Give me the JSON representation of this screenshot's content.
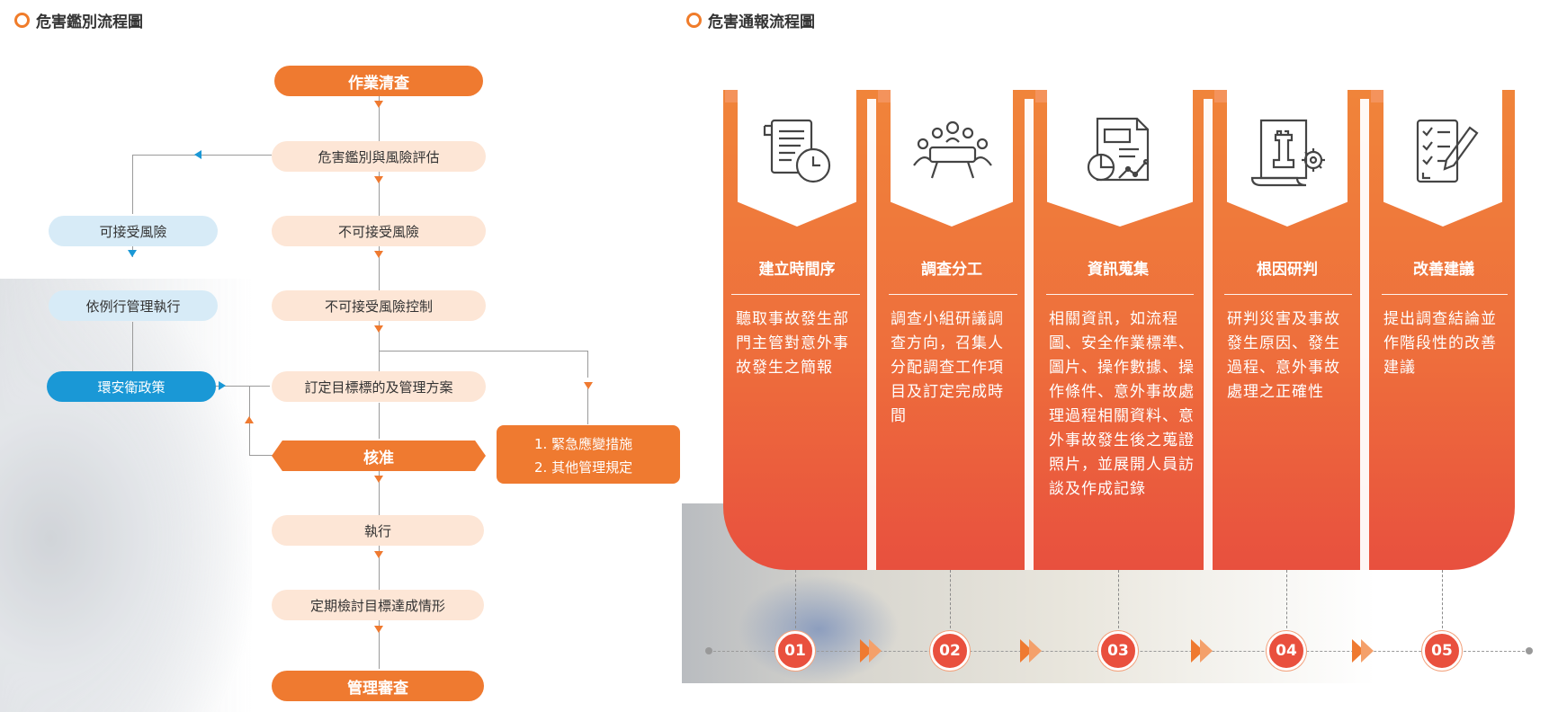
{
  "left": {
    "section_title": "危害鑑別流程圖",
    "nodes": {
      "n1": "作業清查",
      "n2": "危害鑑別與風險評估",
      "n3": "不可接受風險",
      "n4": "不可接受風險控制",
      "n5": "訂定目標標的及管理方案",
      "n6": "核准",
      "n7": "執行",
      "n8": "定期檢討目標達成情形",
      "n9": "管理審查",
      "acceptable": "可接受風險",
      "routine": "依例行管理執行",
      "policy": "環安衛政策",
      "emergency_1": "1. 緊急應變措施",
      "emergency_2": "2. 其他管理規定"
    }
  },
  "right": {
    "section_title": "危害通報流程圖",
    "steps": [
      {
        "num": "01",
        "icon": "timeline-document-clock-icon",
        "title": "建立時間序",
        "text": "聽取事故發生部門主管對意外事故發生之簡報"
      },
      {
        "num": "02",
        "icon": "meeting-table-icon",
        "title": "調查分工",
        "text": "調查小組研議調查方向，召集人分配調查工作項目及訂定完成時間"
      },
      {
        "num": "03",
        "icon": "report-chart-icon",
        "title": "資訊蒐集",
        "text": "相關資訊，如流程圖、安全作業標準、圖片、操作數據、操作條件、意外事故處理過程相關資料、意外事故發生後之蒐證照片，並展開人員訪談及作成記錄"
      },
      {
        "num": "04",
        "icon": "strategy-chess-gear-icon",
        "title": "根因研判",
        "text": "研判災害及事故發生原因、發生過程、意外事故處理之正確性"
      },
      {
        "num": "05",
        "icon": "checklist-pen-icon",
        "title": "改善建議",
        "text": "提出調查結論並作階段性的改善建議"
      }
    ]
  },
  "colors": {
    "accent_orange": "#ef7a30",
    "peach": "#fde6d6",
    "light_blue": "#d7ebf7",
    "blue": "#1a98d6",
    "card_red": "#e8503e"
  }
}
